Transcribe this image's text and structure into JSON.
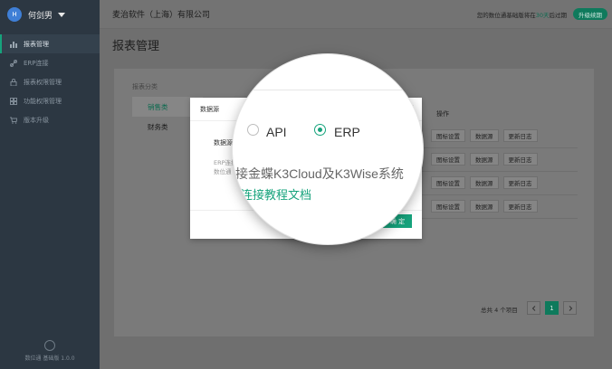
{
  "sidebar": {
    "avatar_letter": "H",
    "user_name": "何剑男",
    "items": [
      {
        "label": "报表管理",
        "icon": "bar-chart-icon",
        "active": true
      },
      {
        "label": "ERP连接",
        "icon": "link-icon",
        "active": false
      },
      {
        "label": "报表权限管理",
        "icon": "lock-icon",
        "active": false
      },
      {
        "label": "功能权限管理",
        "icon": "grid-icon",
        "active": false
      },
      {
        "label": "版本升级",
        "icon": "cart-icon",
        "active": false
      }
    ],
    "footer": "数位通 基础版 1.0.0"
  },
  "header": {
    "company": "麦治软件（上海）有限公司",
    "trial_prefix": "您的数位通基础版将在",
    "trial_days": "30天",
    "trial_suffix": "后过期",
    "upgrade_label": "升级续期"
  },
  "page_title": "报表管理",
  "card": {
    "category_label": "报表分类",
    "categories": [
      "销售类",
      "财务类"
    ],
    "operation_header": "操作",
    "row_buttons": [
      "图标设置",
      "数据源",
      "更新日志"
    ],
    "row_count": 4,
    "total": "总共 4 个项目",
    "current_page": "1"
  },
  "modal": {
    "title": "数据源",
    "datasource_label": "数据源",
    "desc1": "ERP连接",
    "desc2": "数位通",
    "confirm": "确 定"
  },
  "magnifier": {
    "options": [
      {
        "label": "API",
        "checked": false
      },
      {
        "label": "ERP",
        "checked": true
      }
    ],
    "description": "接金蝶K3Cloud及K3Wise系统",
    "link": "连接教程文档"
  },
  "colors": {
    "accent": "#16a37c",
    "sidebar_bg": "#2c3742"
  }
}
